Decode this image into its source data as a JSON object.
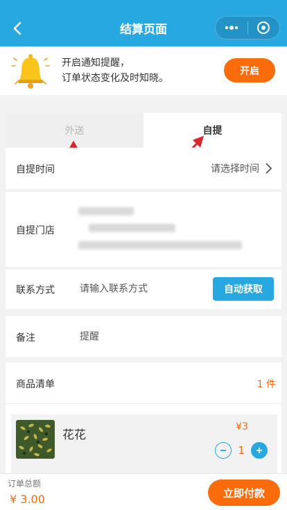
{
  "header": {
    "title": "结算页面",
    "back_icon": "chevron-left-icon",
    "more_icon": "more-dots-icon",
    "close_icon": "target-circle-icon",
    "background": "#27a8e0"
  },
  "notify": {
    "line1": "开启通知提醒，",
    "line2": "订单状态变化及时知晓。",
    "button": "开启",
    "icon": "bell-icon"
  },
  "tabs": [
    {
      "label": "外送",
      "active": false
    },
    {
      "label": "自提",
      "active": true
    }
  ],
  "pickup_time": {
    "label": "自提时间",
    "value": "请选择时间",
    "icon": "chevron-right-icon"
  },
  "store": {
    "label": "自提门店"
  },
  "contact": {
    "label": "联系方式",
    "placeholder": "请输入联系方式",
    "button": "自动获取"
  },
  "remark": {
    "label": "备注",
    "placeholder": "提醒"
  },
  "goods": {
    "label": "商品清单",
    "count": "1 件",
    "items": [
      {
        "name": "花花",
        "price": "¥3",
        "quantity": "1"
      }
    ]
  },
  "footer": {
    "total_label": "订单总额",
    "total_value": "¥ 3.00",
    "pay_button": "立即付款"
  },
  "colors": {
    "primary": "#27a8e0",
    "accent": "#fa6b0c",
    "annotation": "#d9252b"
  }
}
